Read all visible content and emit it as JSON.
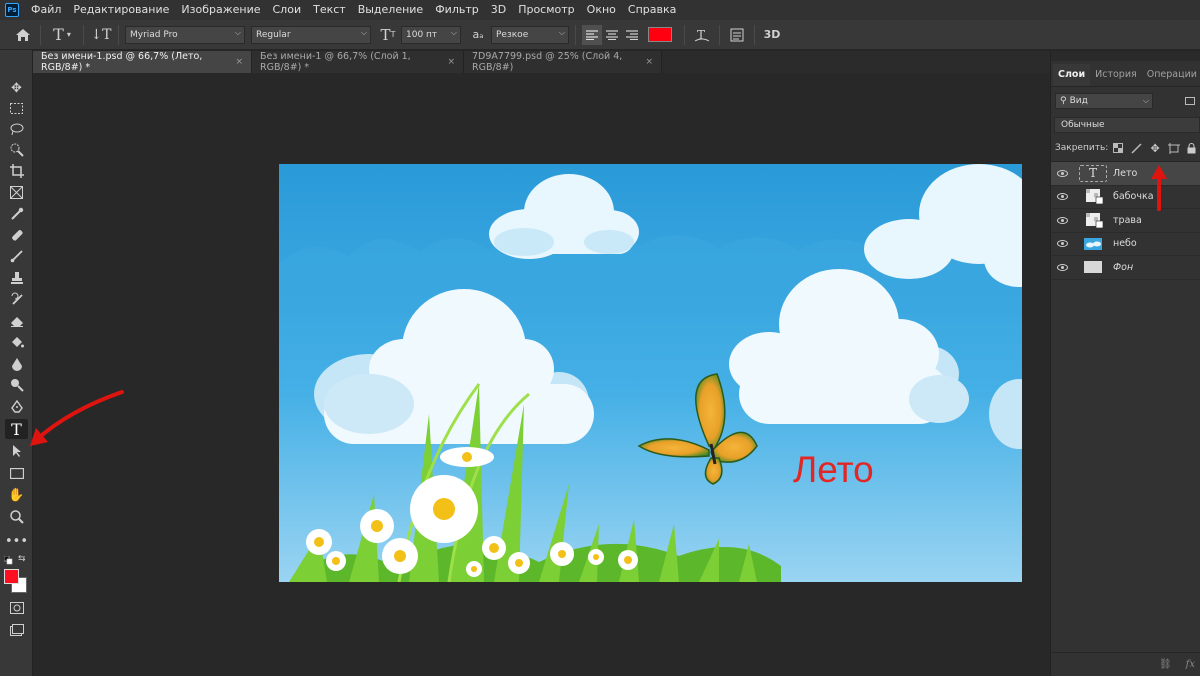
{
  "app": {
    "logo": "Ps"
  },
  "menu": [
    "Файл",
    "Редактирование",
    "Изображение",
    "Слои",
    "Текст",
    "Выделение",
    "Фильтр",
    "3D",
    "Просмотр",
    "Окно",
    "Справка"
  ],
  "options": {
    "font_family": "Myriad Pro",
    "font_style": "Regular",
    "font_size": "100 пт",
    "aa_label": "aₐ",
    "antialias": "Резкое",
    "text_color": "#ff0010",
    "threed": "3D"
  },
  "tabs": [
    {
      "label": "Без имени-1.psd @ 66,7% (Лето, RGB/8#) *",
      "close": "×"
    },
    {
      "label": "Без имени-1 @ 66,7% (Слой 1, RGB/8#) *",
      "close": "×"
    },
    {
      "label": "7D9A7799.psd @ 25% (Слой 4, RGB/8#)",
      "close": "×"
    }
  ],
  "canvas": {
    "text": "Лето",
    "text_color": "#e32624",
    "sky_top": "#2a9ad8",
    "sky_bottom": "#9ad4f2"
  },
  "panel": {
    "tabs": [
      "Слои",
      "История",
      "Операции"
    ],
    "filter": "Вид",
    "blend_mode": "Обычные",
    "lock_label": "Закрепить:",
    "layers": [
      {
        "name": "Лето",
        "type": "text",
        "italic": false
      },
      {
        "name": "бабочка",
        "type": "smart",
        "italic": false
      },
      {
        "name": "трава",
        "type": "smart",
        "italic": false
      },
      {
        "name": "небо",
        "type": "image",
        "italic": false
      },
      {
        "name": "Фон",
        "type": "background",
        "italic": true
      }
    ],
    "bottom_icons": [
      "link-icon",
      "fx-icon"
    ],
    "fx_label": "fx"
  },
  "annotations": {
    "arrow_color": "#e0140e"
  },
  "colors": {
    "foreground": "#ff1020",
    "background": "#ffffff"
  }
}
